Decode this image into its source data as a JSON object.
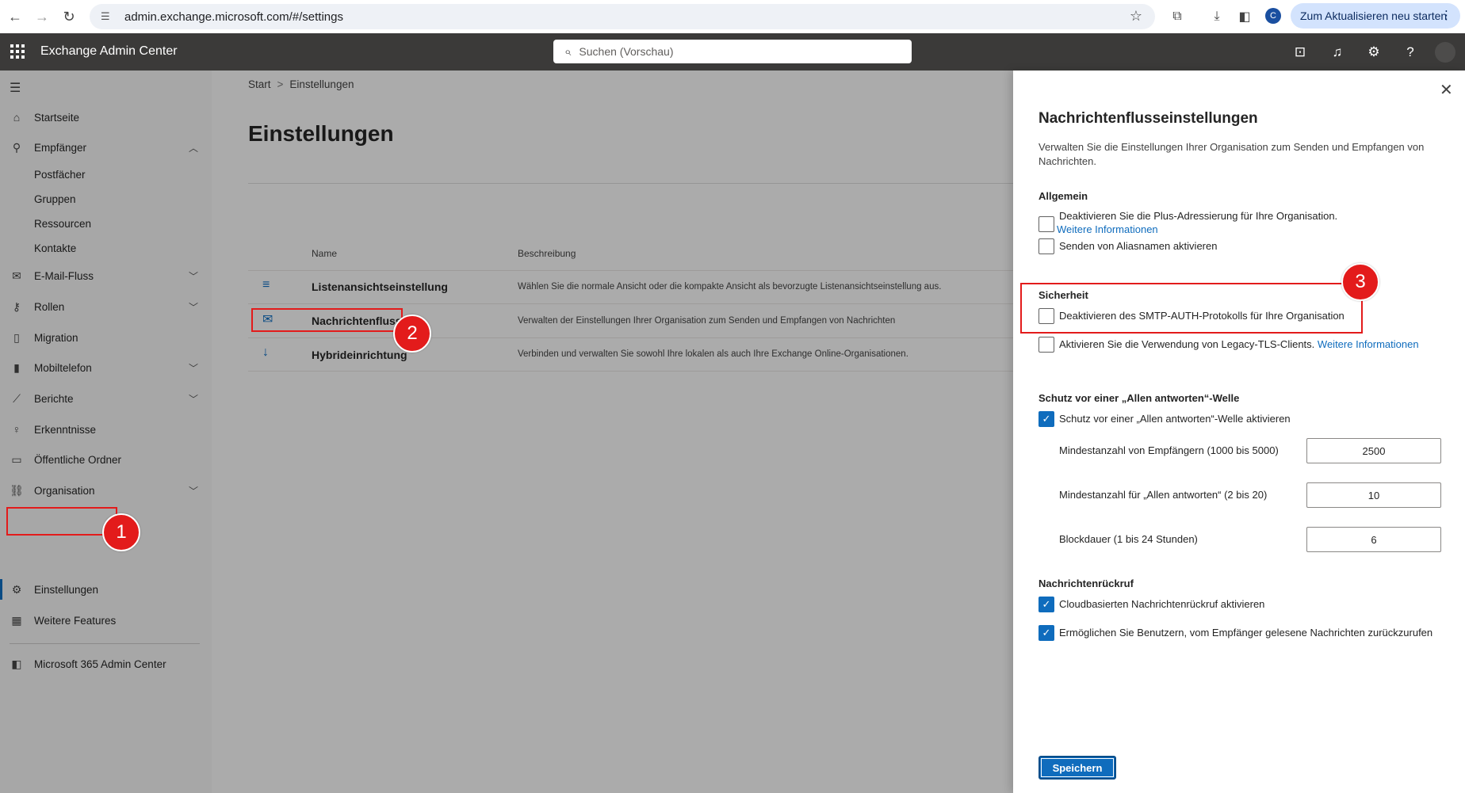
{
  "browser": {
    "url": "admin.exchange.microsoft.com/#/settings",
    "profile_initial": "C",
    "update_label": "Zum Aktualisieren neu starten"
  },
  "header": {
    "app_title": "Exchange Admin Center",
    "search_placeholder": "Suchen (Vorschau)"
  },
  "sidebar": {
    "items": [
      {
        "label": "Startseite",
        "icon": "home-icon"
      },
      {
        "label": "Empfänger",
        "icon": "person-icon",
        "expanded": true
      },
      {
        "label": "E-Mail-Fluss",
        "icon": "mail-icon"
      },
      {
        "label": "Rollen",
        "icon": "roles-icon"
      },
      {
        "label": "Migration",
        "icon": "migration-icon"
      },
      {
        "label": "Mobiltelefon",
        "icon": "mobile-icon"
      },
      {
        "label": "Berichte",
        "icon": "chart-icon"
      },
      {
        "label": "Erkenntnisse",
        "icon": "lightbulb-icon"
      },
      {
        "label": "Öffentliche Ordner",
        "icon": "folder-icon"
      },
      {
        "label": "Organisation",
        "icon": "org-icon"
      },
      {
        "label": "Einstellungen",
        "icon": "gear-icon",
        "active": true
      },
      {
        "label": "Weitere Features",
        "icon": "table-icon"
      },
      {
        "label": "Microsoft 365 Admin Center",
        "icon": "office-icon"
      }
    ],
    "subitems": [
      "Postfächer",
      "Gruppen",
      "Ressourcen",
      "Kontakte"
    ]
  },
  "main": {
    "breadcrumb": [
      "Start",
      "Einstellungen"
    ],
    "title": "Einstellungen",
    "columns": [
      "Name",
      "Beschreibung"
    ],
    "rows": [
      {
        "name": "Listenansichtseinstellung",
        "desc": "Wählen Sie die normale Ansicht oder die kompakte Ansicht als bevorzugte Listenansichtseinstellung aus."
      },
      {
        "name": "Nachrichtenfluss",
        "desc": "Verwalten der Einstellungen Ihrer Organisation zum Senden und Empfangen von Nachrichten"
      },
      {
        "name": "Hybrideinrichtung",
        "desc": "Verbinden und verwalten Sie sowohl Ihre lokalen als auch Ihre Exchange Online-Organisationen."
      }
    ]
  },
  "annotations": [
    "1",
    "2",
    "3"
  ],
  "panel": {
    "title": "Nachrichtenflusseinstellungen",
    "intro": "Verwalten Sie die Einstellungen Ihrer Organisation zum Senden und Empfangen von Nachrichten.",
    "general": {
      "heading": "Allgemein",
      "plus_addressing": "Deaktivieren Sie die Plus-Adressierung für Ihre Organisation.",
      "more_info": "Weitere Informationen",
      "alias_sending": "Senden von Aliasnamen aktivieren"
    },
    "security": {
      "heading": "Sicherheit",
      "smtp_auth": "Deaktivieren des SMTP-AUTH-Protokolls für Ihre Organisation",
      "legacy_tls": "Aktivieren Sie die Verwendung von Legacy-TLS-Clients.",
      "more_info": "Weitere Informationen"
    },
    "reply_all": {
      "heading": "Schutz vor einer „Allen antworten“-Welle",
      "enable": "Schutz vor einer „Allen antworten“-Welle aktivieren",
      "min_recipients_label": "Mindestanzahl von Empfängern (1000 bis 5000)",
      "min_recipients_value": "2500",
      "min_replyall_label": "Mindestanzahl für „Allen antworten“ (2 bis 20)",
      "min_replyall_value": "10",
      "block_duration_label": "Blockdauer (1 bis 24 Stunden)",
      "block_duration_value": "6"
    },
    "recall": {
      "heading": "Nachrichtenrückruf",
      "cloud_recall": "Cloudbasierten Nachrichtenrückruf aktivieren",
      "read_recall": "Ermöglichen Sie Benutzern, vom Empfänger gelesene Nachrichten zurückzurufen"
    },
    "save_label": "Speichern"
  }
}
